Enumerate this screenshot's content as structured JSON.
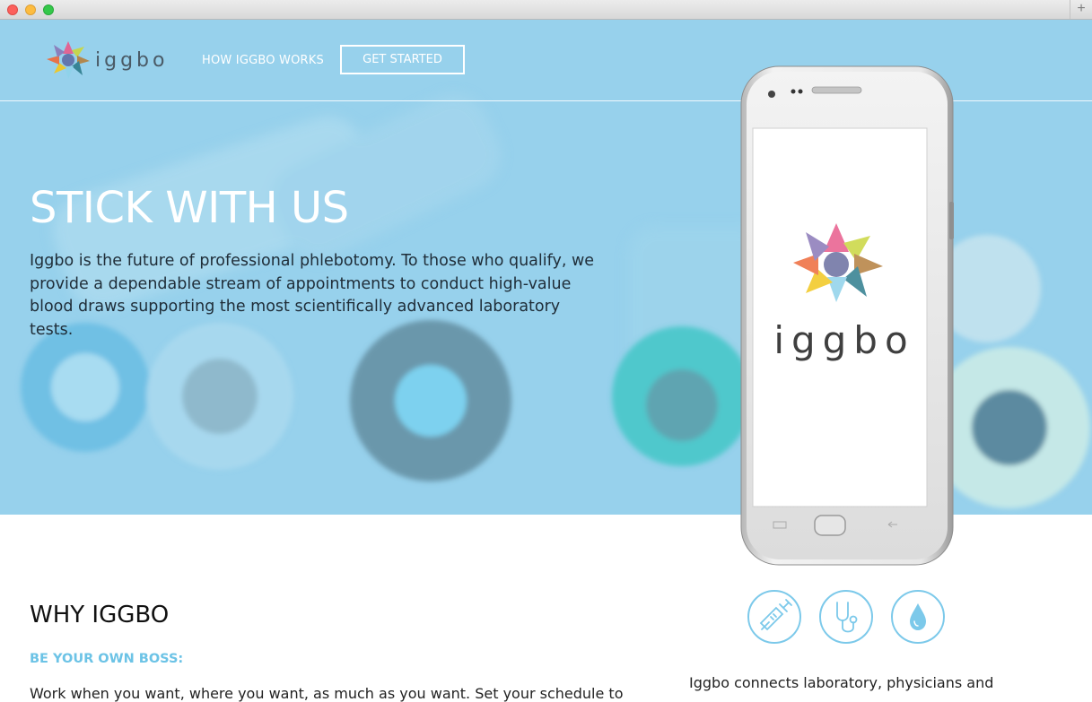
{
  "brand": {
    "name": "iggbo",
    "logo_colors": [
      "#e85c8c",
      "#c9d640",
      "#b5803f",
      "#2f7d8e",
      "#8fd2ea",
      "#f2c71f",
      "#ee6b3b",
      "#8a79b8"
    ]
  },
  "nav": {
    "how_it_works": "HOW IGGBO WORKS",
    "get_started": "GET STARTED"
  },
  "hero": {
    "title": "STICK WITH US",
    "text": "Iggbo is the future of professional phlebotomy. To those who qualify, we provide a dependable stream of appointments to conduct high-value blood draws supporting the most scientifically advanced laboratory tests."
  },
  "phone": {
    "screen_logo_text": "iggbo"
  },
  "why": {
    "title": "WHY IGGBO",
    "subheading": "BE YOUR OWN BOSS:",
    "text": "Work when you want, where you want, as much as you want. Set your schedule to"
  },
  "features": {
    "icons": [
      "syringe-icon",
      "stethoscope-icon",
      "blood-drop-icon"
    ],
    "accent": "#7cc9ea",
    "text": "Iggbo connects laboratory, physicians and"
  },
  "colors": {
    "hero_bg": "#97d1ec",
    "accent": "#6cc3e6"
  }
}
